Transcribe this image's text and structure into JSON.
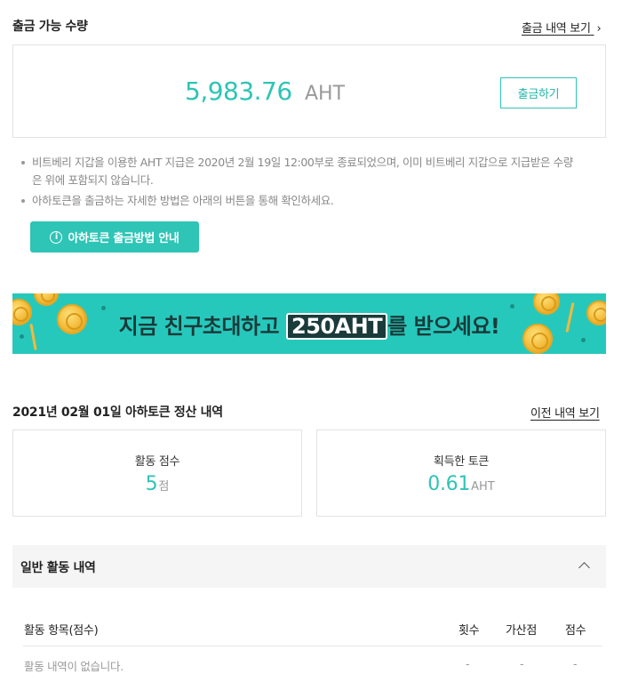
{
  "withdrawable": {
    "title": "출금 가능 수량",
    "history_link": "출금 내역 보기",
    "amount": "5,983.76",
    "unit": "AHT",
    "withdraw_button": "출금하기"
  },
  "notices": [
    "비트베리 지갑을 이용한 AHT 지급은 2020년 2월 19일 12:00부로 종료되었으며, 이미 비트베리 지갑으로 지급받은 수량",
    "은 위에 포함되지 않습니다.",
    "아하토큰을 출금하는 자세한 방법은 아래의 버튼을 통해 확인하세요."
  ],
  "guide_button": "아하토큰 출금방법 안내",
  "banner": {
    "text_before": "지금 친구초대하고",
    "highlight": "250AHT",
    "text_after": "를 받으세요!"
  },
  "settlement": {
    "title": "2021년 02월 01일 아하토큰 정산 내역",
    "prev_link": "이전 내역 보기",
    "activity_score_label": "활동 점수",
    "activity_score_value": "5",
    "activity_score_unit": "점",
    "earned_token_label": "획득한 토큰",
    "earned_token_value": "0.61",
    "earned_token_unit": "AHT"
  },
  "general_activity": {
    "title": "일반 활동 내역",
    "columns": [
      "활동 항목(점수)",
      "횟수",
      "가산점",
      "점수"
    ],
    "empty_text": "활동 내역이 없습니다.",
    "empty_cells": [
      "-",
      "-",
      "-"
    ]
  },
  "colors": {
    "accent": "#2ec4b6",
    "banner_bg": "#27c8bc"
  }
}
